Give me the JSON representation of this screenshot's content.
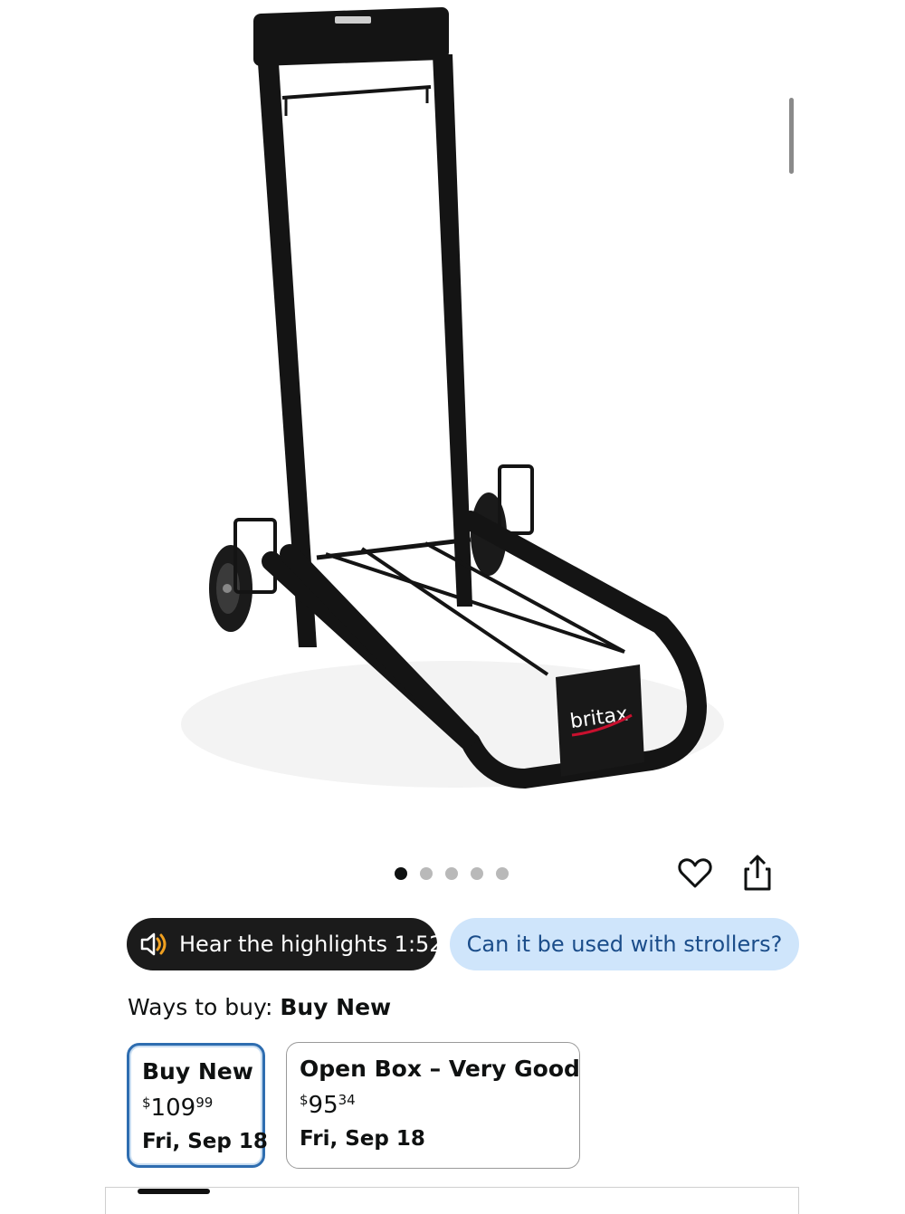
{
  "product": {
    "brand_text": "britax"
  },
  "carousel": {
    "total_images": 5,
    "active_index": 0
  },
  "icons": {
    "wishlist": "heart-icon",
    "share": "share-icon",
    "audio": "speaker-icon"
  },
  "highlights": {
    "label": "Hear the highlights 1:52"
  },
  "question_chip": {
    "label": "Can it be used with strollers?"
  },
  "ways_to_buy": {
    "prefix": "Ways to buy:",
    "selected": "Buy New"
  },
  "options": [
    {
      "title": "Buy New",
      "currency": "$",
      "price_whole": "109",
      "price_fraction": "99",
      "delivery": "Fri, Sep 18",
      "selected": true
    },
    {
      "title": "Open Box – Very Good",
      "currency": "$",
      "price_whole": "95",
      "price_fraction": "34",
      "delivery": "Fri, Sep 18",
      "selected": false
    }
  ],
  "colors": {
    "selected_border": "#2e6db0",
    "chip_background": "#cfe5fb",
    "chip_text": "#1b4d8a",
    "audio_accent": "#f0a020",
    "pill_dark": "#1b1b1b"
  }
}
